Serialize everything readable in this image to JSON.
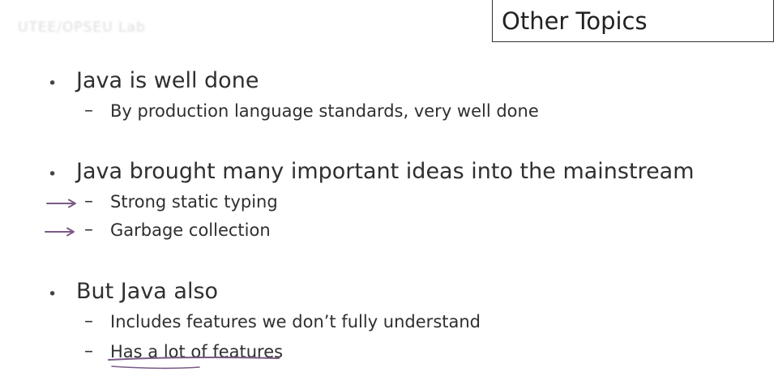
{
  "watermark": {
    "text": "UTEE/OPSEU Lab"
  },
  "slide": {
    "title": "Other Topics"
  },
  "points": [
    {
      "text": "Java is well done",
      "subpoints": [
        "By production language standards, very well done"
      ]
    },
    {
      "text": "Java brought many important ideas into the mainstream",
      "subpoints": [
        "Strong static typing",
        "Garbage collection"
      ]
    },
    {
      "text": "But Java also",
      "subpoints": [
        "Includes features we don’t fully understand",
        "Has a lot of features"
      ]
    }
  ],
  "symbols": {
    "bullet": "•",
    "dash": "–"
  },
  "annotations": {
    "ink_color": "#7a5a86"
  }
}
